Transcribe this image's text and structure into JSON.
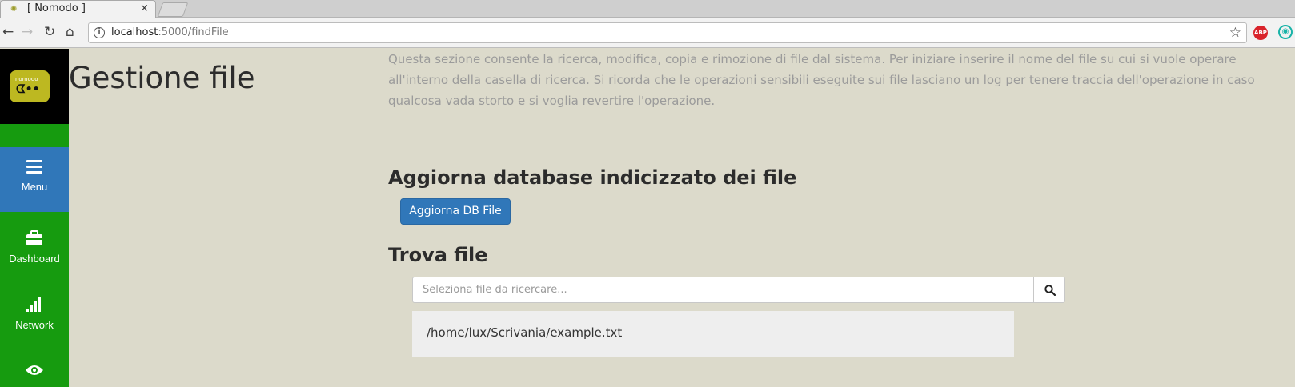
{
  "browser": {
    "tab_title": "[ Nomodo ]",
    "tab_close": "×",
    "url_host": "localhost",
    "url_path": ":5000/findFile",
    "abp_label": "ABP",
    "icons": [
      "back-icon",
      "forward-icon",
      "reload-icon",
      "home-icon",
      "info-icon",
      "star-icon",
      "adblock-icon",
      "extension-icon"
    ]
  },
  "sidebar": {
    "logo_text": "nomodo",
    "items": [
      {
        "label": "Menu",
        "icon": "hamburger-icon",
        "active": true
      },
      {
        "label": "Dashboard",
        "icon": "briefcase-icon",
        "active": false
      },
      {
        "label": "Network",
        "icon": "signal-bars-icon",
        "active": false
      },
      {
        "label": "",
        "icon": "eye-icon",
        "active": false
      }
    ]
  },
  "main": {
    "title": "Gestione file",
    "intro": "Questa sezione consente la ricerca, modifica, copia e rimozione di file dal sistema. Per iniziare inserire il nome del file su cui si vuole operare all'interno della casella di ricerca. Si ricorda che le operazioni sensibili eseguite sui file lasciano un log per tenere traccia dell'operazione in caso qualcosa vada storto e si voglia revertire l'operazione.",
    "update_heading": "Aggiorna database indicizzato dei file",
    "update_button": "Aggiorna DB File",
    "find_heading": "Trova file",
    "search_placeholder": "Seleziona file da ricercare...",
    "search_value": "",
    "result": "/home/lux/Scrivania/example.txt"
  },
  "colors": {
    "sidebar_green": "#169b0f",
    "accent_blue": "#3077b9",
    "page_bg": "#dcdacb"
  }
}
